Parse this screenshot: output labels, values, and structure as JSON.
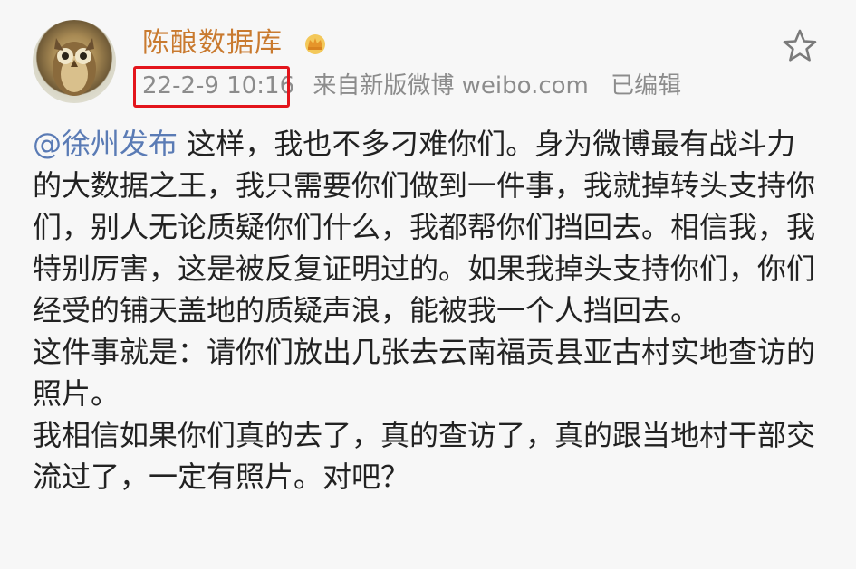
{
  "post": {
    "username": "陈酿数据库",
    "timestamp": "22-2-9 10:16",
    "source": "来自新版微博 weibo.com",
    "edited": "已编辑",
    "mention": "@徐州发布",
    "paragraphs": [
      " 这样，我也不多刁难你们。身为微博最有战斗力的大数据之王，我只需要你们做到一件事，我就掉转头支持你们，别人无论质疑你们什么，我都帮你们挡回去。相信我，我特别厉害，这是被反复证明过的。如果我掉头支持你们，你们经受的铺天盖地的质疑声浪，能被我一个人挡回去。",
      "这件事就是：请你们放出几张去云南福贡县亚古村实地查访的照片。",
      "我相信如果你们真的去了，真的查访了，真的跟当地村干部交流过了，一定有照片。对吧？"
    ]
  },
  "icons": {
    "avatar": "owl-avatar",
    "badge": "crown-vip-icon",
    "favorite": "star-icon"
  },
  "colors": {
    "username": "#c97a2f",
    "highlight_box": "#e3151c",
    "mention": "#5a7bb5",
    "meta": "#8c8c8c"
  }
}
